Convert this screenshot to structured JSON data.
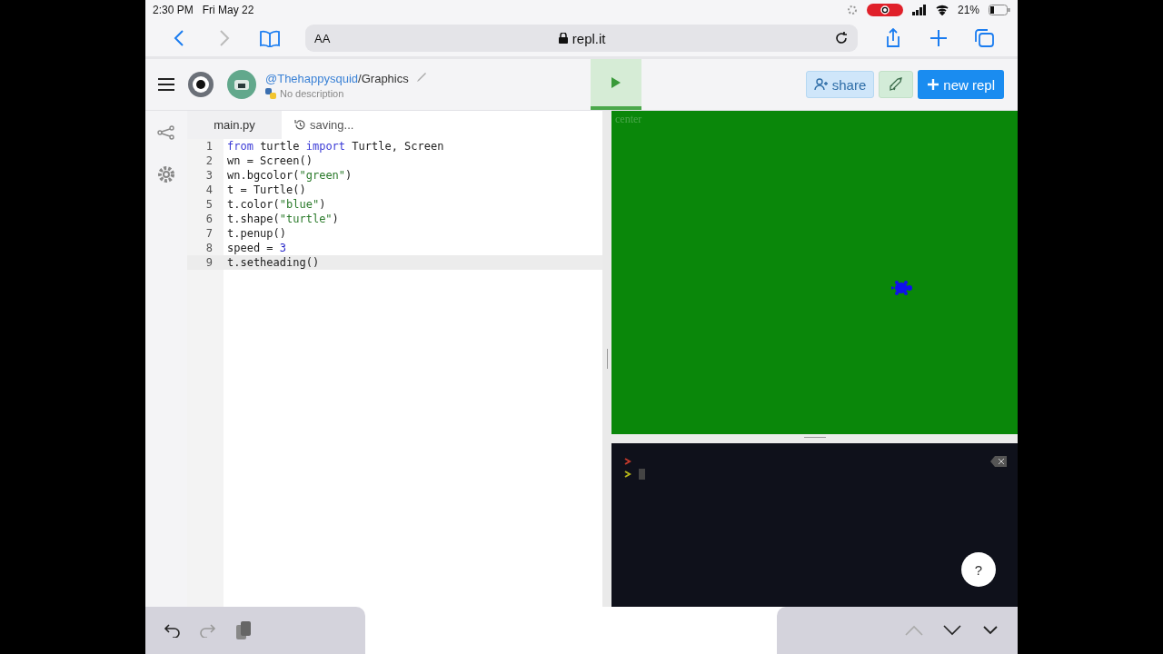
{
  "status_bar": {
    "time": "2:30 PM",
    "date": "Fri May 22",
    "battery": "21%"
  },
  "browser": {
    "text_size": "AA",
    "url": "repl.it"
  },
  "header": {
    "owner": "@Thehappysquid",
    "repl_name": "/Graphics",
    "description": "No description",
    "share": "share",
    "new_repl": "new repl"
  },
  "editor": {
    "tab": "main.py",
    "status": "saving...",
    "lines": [
      {
        "number": "1",
        "active": false,
        "tokens": [
          {
            "text": "from",
            "kind": "keyword"
          },
          {
            "text": " turtle ",
            "kind": "plain"
          },
          {
            "text": "import",
            "kind": "keyword"
          },
          {
            "text": " Turtle, Screen",
            "kind": "plain"
          }
        ]
      },
      {
        "number": "2",
        "active": false,
        "tokens": [
          {
            "text": "wn = Screen()",
            "kind": "plain"
          }
        ]
      },
      {
        "number": "3",
        "active": false,
        "tokens": [
          {
            "text": "wn.bgcolor(",
            "kind": "plain"
          },
          {
            "text": "\"green\"",
            "kind": "string"
          },
          {
            "text": ")",
            "kind": "plain"
          }
        ]
      },
      {
        "number": "4",
        "active": false,
        "tokens": [
          {
            "text": "t = Turtle()",
            "kind": "plain"
          }
        ]
      },
      {
        "number": "5",
        "active": false,
        "tokens": [
          {
            "text": "t.color(",
            "kind": "plain"
          },
          {
            "text": "\"blue\"",
            "kind": "string"
          },
          {
            "text": ")",
            "kind": "plain"
          }
        ]
      },
      {
        "number": "6",
        "active": false,
        "tokens": [
          {
            "text": "t.shape(",
            "kind": "plain"
          },
          {
            "text": "\"turtle\"",
            "kind": "string"
          },
          {
            "text": ")",
            "kind": "plain"
          }
        ]
      },
      {
        "number": "7",
        "active": false,
        "tokens": [
          {
            "text": "t.penup()",
            "kind": "plain"
          }
        ]
      },
      {
        "number": "8",
        "active": false,
        "tokens": [
          {
            "text": "speed = ",
            "kind": "plain"
          },
          {
            "text": "3",
            "kind": "number"
          }
        ]
      },
      {
        "number": "9",
        "active": true,
        "tokens": [
          {
            "text": "t.setheading()",
            "kind": "plain"
          }
        ]
      }
    ]
  },
  "canvas": {
    "label": "center"
  },
  "help": "?"
}
